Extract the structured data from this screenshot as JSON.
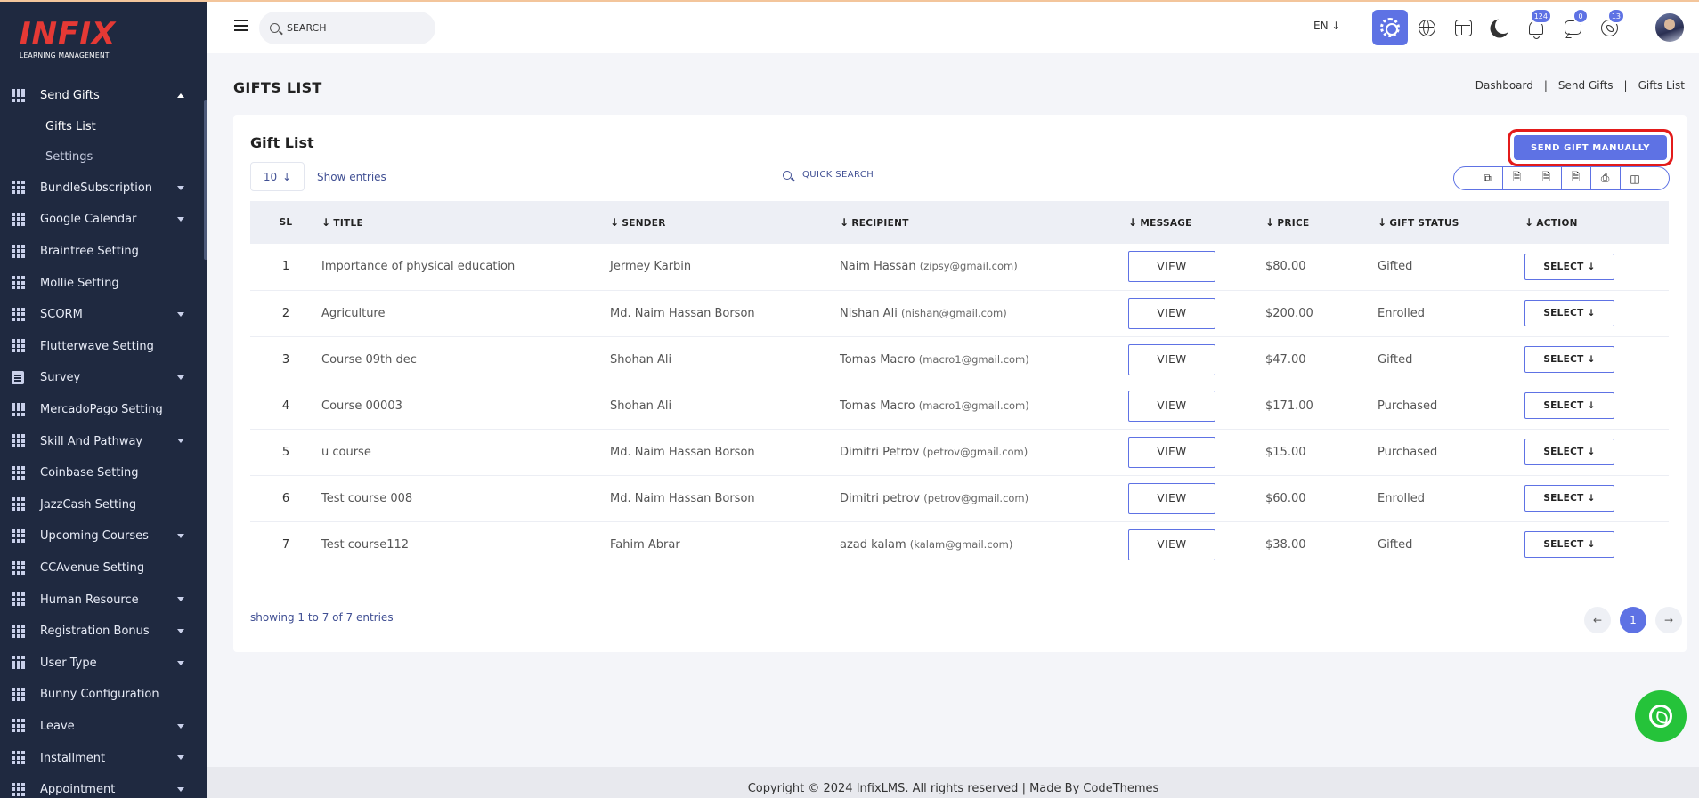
{
  "brand": {
    "mark": "INFIX",
    "subtitle": "LEARNING MANAGEMENT"
  },
  "sidebar": {
    "items": [
      {
        "label": "Send Gifts",
        "icon": "grid-icon",
        "expanded": true,
        "submenu": [
          {
            "label": "Gifts List",
            "current": true
          },
          {
            "label": "Settings",
            "current": false
          }
        ]
      },
      {
        "label": "BundleSubscription",
        "icon": "grid-icon",
        "caret": true
      },
      {
        "label": "Google Calendar",
        "icon": "grid-icon",
        "caret": true
      },
      {
        "label": "Braintree Setting",
        "icon": "grid-icon",
        "caret": false
      },
      {
        "label": "Mollie Setting",
        "icon": "grid-icon",
        "caret": false
      },
      {
        "label": "SCORM",
        "icon": "grid-icon",
        "caret": true
      },
      {
        "label": "Flutterwave Setting",
        "icon": "grid-icon",
        "caret": false
      },
      {
        "label": "Survey",
        "icon": "document-icon",
        "caret": true
      },
      {
        "label": "MercadoPago Setting",
        "icon": "grid-icon",
        "caret": false
      },
      {
        "label": "Skill And Pathway",
        "icon": "grid-icon",
        "caret": true
      },
      {
        "label": "Coinbase Setting",
        "icon": "grid-icon",
        "caret": false
      },
      {
        "label": "JazzCash Setting",
        "icon": "grid-icon",
        "caret": false
      },
      {
        "label": "Upcoming Courses",
        "icon": "grid-icon",
        "caret": true
      },
      {
        "label": "CCAvenue Setting",
        "icon": "grid-icon",
        "caret": false
      },
      {
        "label": "Human Resource",
        "icon": "grid-icon",
        "caret": true
      },
      {
        "label": "Registration Bonus",
        "icon": "grid-icon",
        "caret": true
      },
      {
        "label": "User Type",
        "icon": "grid-icon",
        "caret": true
      },
      {
        "label": "Bunny Configuration",
        "icon": "grid-icon",
        "caret": false
      },
      {
        "label": "Leave",
        "icon": "grid-icon",
        "caret": true
      },
      {
        "label": "Installment",
        "icon": "grid-icon",
        "caret": true
      },
      {
        "label": "Appointment",
        "icon": "grid-icon",
        "caret": true
      }
    ]
  },
  "header": {
    "search_placeholder": "SEARCH",
    "language": "EN",
    "notifications": {
      "bell": "124",
      "chat": "0",
      "whatsapp": "13"
    }
  },
  "page": {
    "title": "GIFTS LIST",
    "breadcrumb": [
      "Dashboard",
      "Send Gifts",
      "Gifts List"
    ]
  },
  "card": {
    "title": "Gift List",
    "send_button": "SEND GIFT MANUALLY",
    "entries_value": "10",
    "entries_label": "Show entries",
    "quick_search_placeholder": "QUICK SEARCH",
    "export_icons": [
      "copy-icon",
      "csv-icon",
      "excel-icon",
      "pdf-icon",
      "print-icon",
      "columns-icon"
    ]
  },
  "table": {
    "headers": [
      "SL",
      "TITLE",
      "SENDER",
      "RECIPIENT",
      "MESSAGE",
      "PRICE",
      "GIFT STATUS",
      "ACTION"
    ],
    "view_label": "VIEW",
    "select_label": "SELECT",
    "rows": [
      {
        "sl": "1",
        "title": "Importance of physical education",
        "sender": "Jermey Karbin",
        "recipient": "Naim Hassan",
        "email": "(zipsy@gmail.com)",
        "price": "$80.00",
        "status": "Gifted"
      },
      {
        "sl": "2",
        "title": "Agriculture",
        "sender": "Md. Naim Hassan Borson",
        "recipient": "Nishan Ali",
        "email": "(nishan@gmail.com)",
        "price": "$200.00",
        "status": "Enrolled"
      },
      {
        "sl": "3",
        "title": "Course 09th dec",
        "sender": "Shohan Ali",
        "recipient": "Tomas Macro",
        "email": "(macro1@gmail.com)",
        "price": "$47.00",
        "status": "Gifted"
      },
      {
        "sl": "4",
        "title": "Course 00003",
        "sender": "Shohan Ali",
        "recipient": "Tomas Macro",
        "email": "(macro1@gmail.com)",
        "price": "$171.00",
        "status": "Purchased"
      },
      {
        "sl": "5",
        "title": "u course",
        "sender": "Md. Naim Hassan Borson",
        "recipient": "Dimitri Petrov",
        "email": "(petrov@gmail.com)",
        "price": "$15.00",
        "status": "Purchased"
      },
      {
        "sl": "6",
        "title": "Test course 008",
        "sender": "Md. Naim Hassan Borson",
        "recipient": "Dimitri petrov",
        "email": "(petrov@gmail.com)",
        "price": "$60.00",
        "status": "Enrolled"
      },
      {
        "sl": "7",
        "title": "Test course112",
        "sender": "Fahim Abrar",
        "recipient": "azad kalam",
        "email": "(kalam@gmail.com)",
        "price": "$38.00",
        "status": "Gifted"
      }
    ],
    "info": "showing 1 to 7 of 7 entries",
    "current_page": "1"
  },
  "footer": {
    "text": "Copyright © 2024 InfixLMS. All rights reserved | Made By CodeThemes"
  },
  "colors": {
    "sidebar_bg": "#1f2940",
    "accent": "#5e72e4",
    "highlight_border": "#e31b1b",
    "whatsapp": "#25c33a"
  }
}
